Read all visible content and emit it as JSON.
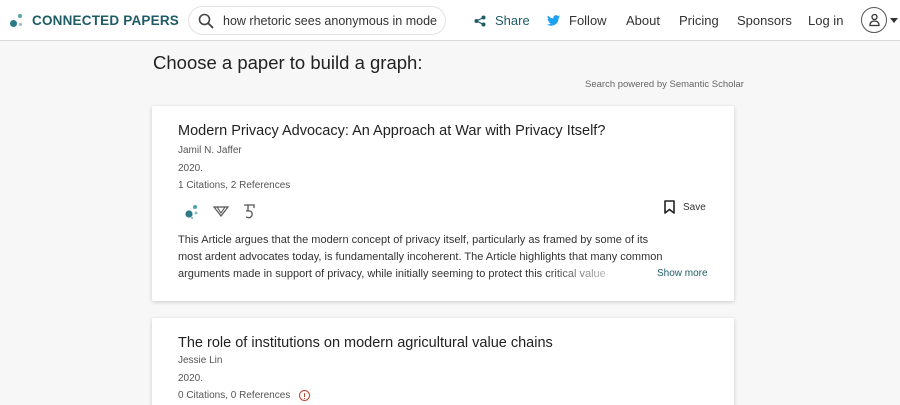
{
  "header": {
    "logo_text": "CONNECTED PAPERS",
    "search": {
      "value": "how rhetoric sees anonymous in modern"
    },
    "nav": {
      "share": "Share",
      "follow": "Follow",
      "about": "About",
      "pricing": "Pricing",
      "sponsors": "Sponsors",
      "login": "Log in"
    },
    "icons": {
      "search": "search-icon",
      "share": "share-icon",
      "follow": "twitter-icon",
      "account": "user-icon"
    }
  },
  "main": {
    "title": "Choose a paper to build a graph:",
    "powered_by": "Search powered by Semantic Scholar",
    "results": [
      {
        "title": "Modern Privacy Advocacy: An Approach at War with Privacy Itself?",
        "author": "Jamil N. Jaffer",
        "year": "2020.",
        "citations": "1 Citations, 2 References",
        "save_label": "Save",
        "abstract_lines": [
          "This Article argues that the modern concept of privacy itself, particularly as framed by some of its",
          "most ardent advocates today, is fundamentally incoherent. The Article highlights that many common",
          "arguments made in support of privacy, while initially seeming to protect this critical value"
        ],
        "show_more": "Show more"
      },
      {
        "title": "The role of institutions on modern agricultural value chains",
        "author": "Jessie Lin",
        "year": "2020.",
        "citations": "0 Citations, 0 References"
      }
    ]
  },
  "colors": {
    "brand": "#1e5c66",
    "twitter": "#1da1f2",
    "warning": "#c1442e",
    "background": "#f7f7f7"
  }
}
